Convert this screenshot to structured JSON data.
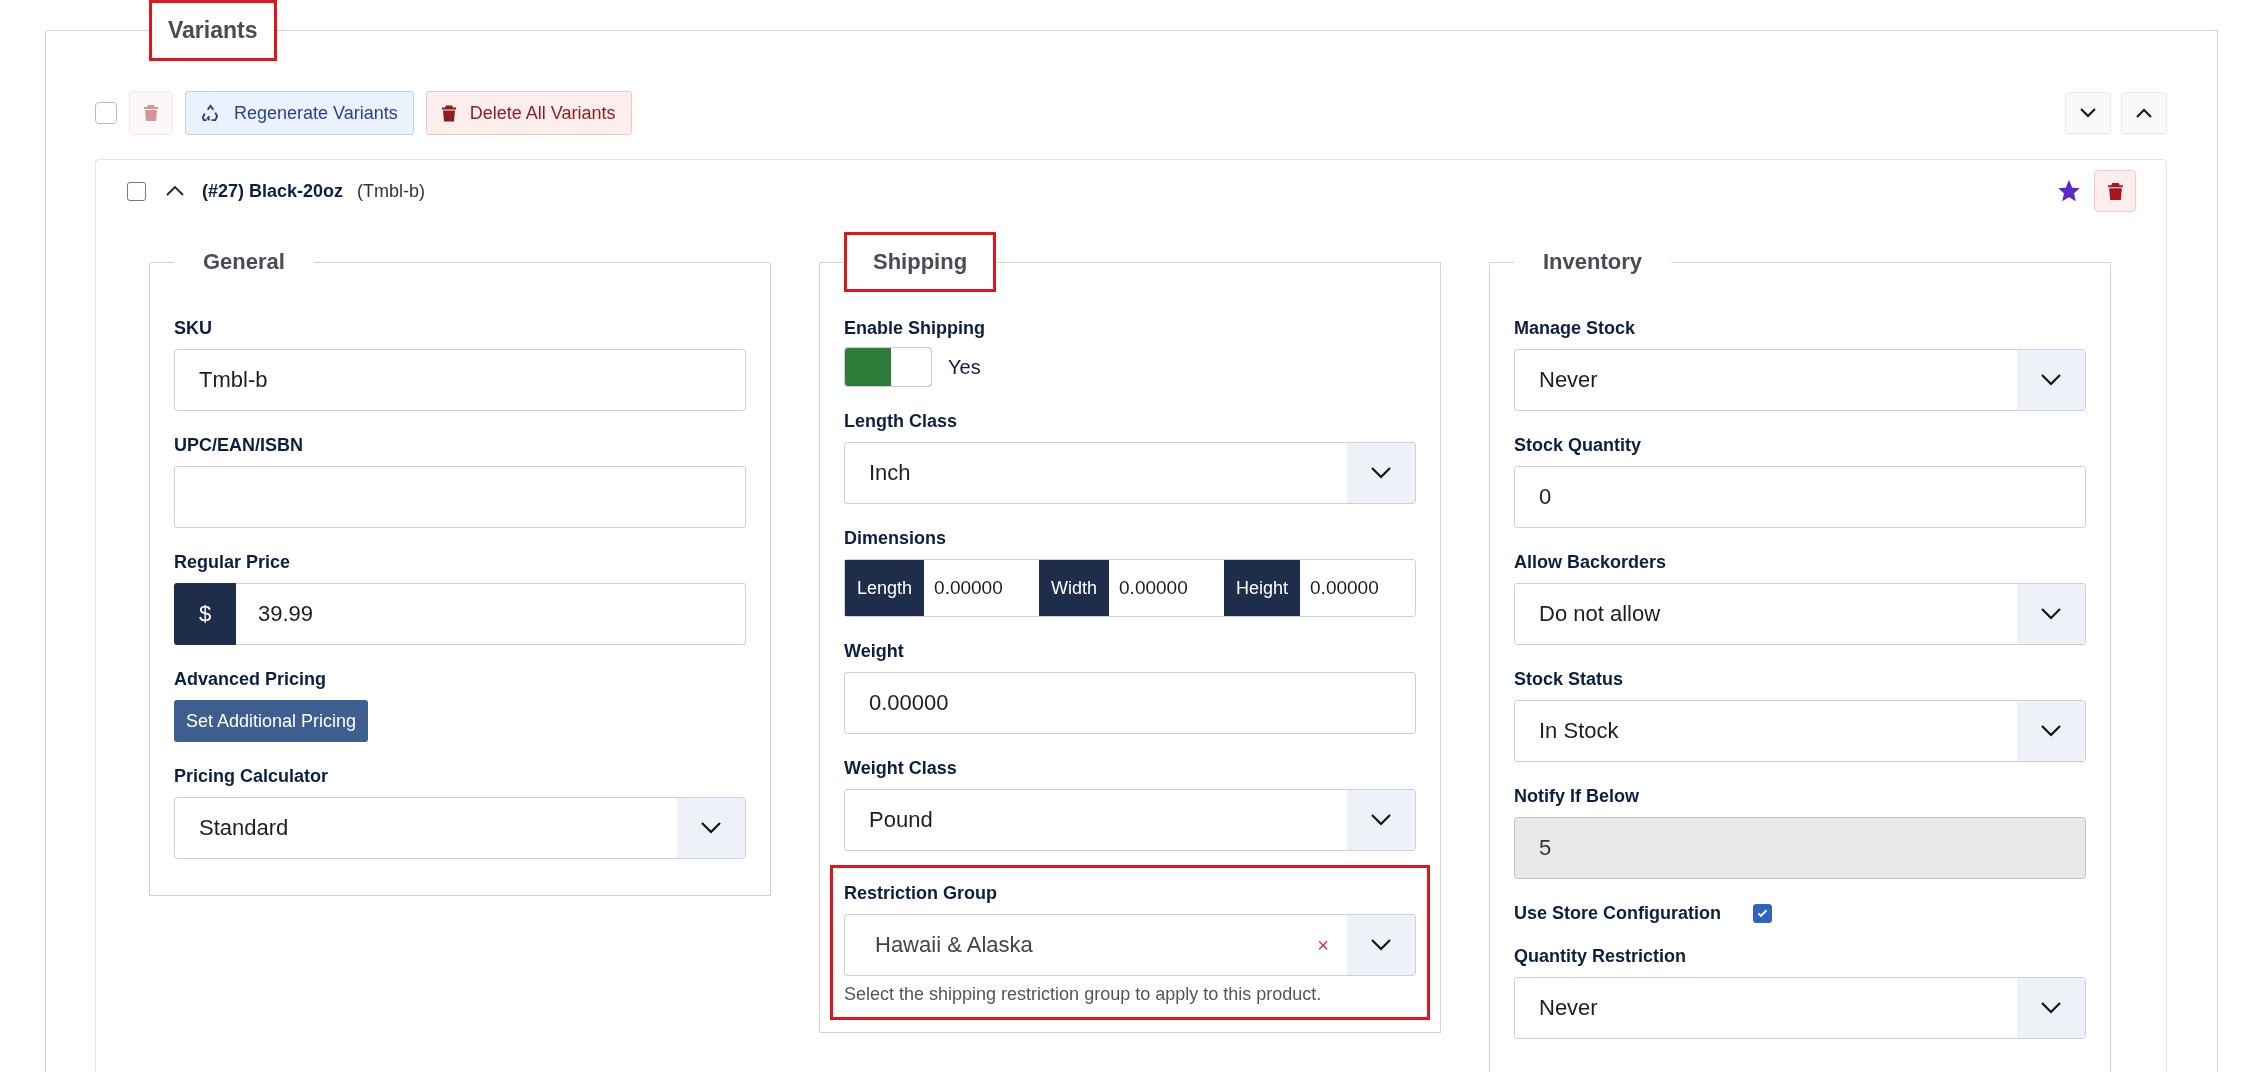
{
  "variants_panel": {
    "title": "Variants",
    "highlighted": true,
    "toolbar": {
      "select_all": {
        "checked": false
      },
      "delete_selected": {
        "disabled": true
      },
      "regenerate": {
        "label": "Regenerate Variants"
      },
      "delete_all": {
        "label": "Delete All Variants"
      }
    },
    "variant": {
      "checked": false,
      "expanded": true,
      "title": "(#27) Black-20oz",
      "sku_tag": "(Tmbl-b)",
      "starred": true,
      "sections": [
        {
          "title": "General",
          "highlighted": false,
          "fields": [
            {
              "kind": "text",
              "label": "SKU",
              "value": "Tmbl-b"
            },
            {
              "kind": "text",
              "label": "UPC/EAN/ISBN"
            },
            {
              "kind": "price",
              "label": "Regular Price",
              "prefix": "$",
              "value": "39.99"
            },
            {
              "kind": "button",
              "label": "Advanced Pricing",
              "button_label": "Set Additional Pricing"
            },
            {
              "kind": "select",
              "label": "Pricing Calculator",
              "value": "Standard"
            }
          ]
        },
        {
          "title": "Shipping",
          "highlighted": true,
          "fields": [
            {
              "kind": "toggle",
              "label": "Enable Shipping",
              "on": true,
              "value_label": "Yes"
            },
            {
              "kind": "select",
              "label": "Length Class",
              "value": "Inch"
            },
            {
              "kind": "dimensions",
              "label": "Dimensions",
              "parts": [
                {
                  "label": "Length",
                  "value": "0.00000"
                },
                {
                  "label": "Width",
                  "value": "0.00000"
                },
                {
                  "label": "Height",
                  "value": "0.00000"
                }
              ]
            },
            {
              "kind": "text",
              "label": "Weight",
              "value": "0.00000"
            },
            {
              "kind": "select",
              "label": "Weight Class",
              "value": "Pound"
            },
            {
              "kind": "select",
              "label": "Restriction Group",
              "value": "Hawaii & Alaska",
              "clear": "×",
              "help": "Select the shipping restriction group to apply to this product.",
              "highlighted": true
            }
          ]
        },
        {
          "title": "Inventory",
          "highlighted": false,
          "fields": [
            {
              "kind": "select",
              "label": "Manage Stock",
              "value": "Never"
            },
            {
              "kind": "text",
              "label": "Stock Quantity",
              "value": "0"
            },
            {
              "kind": "select",
              "label": "Allow Backorders",
              "value": "Do not allow"
            },
            {
              "kind": "select",
              "label": "Stock Status",
              "value": "In Stock"
            },
            {
              "kind": "text",
              "label": "Notify If Below",
              "value": "5",
              "disabled": true
            },
            {
              "kind": "checkbox",
              "label": "Use Store Configuration",
              "checked": true
            },
            {
              "kind": "select",
              "label": "Quantity Restriction",
              "value": "Never"
            }
          ]
        }
      ]
    }
  }
}
